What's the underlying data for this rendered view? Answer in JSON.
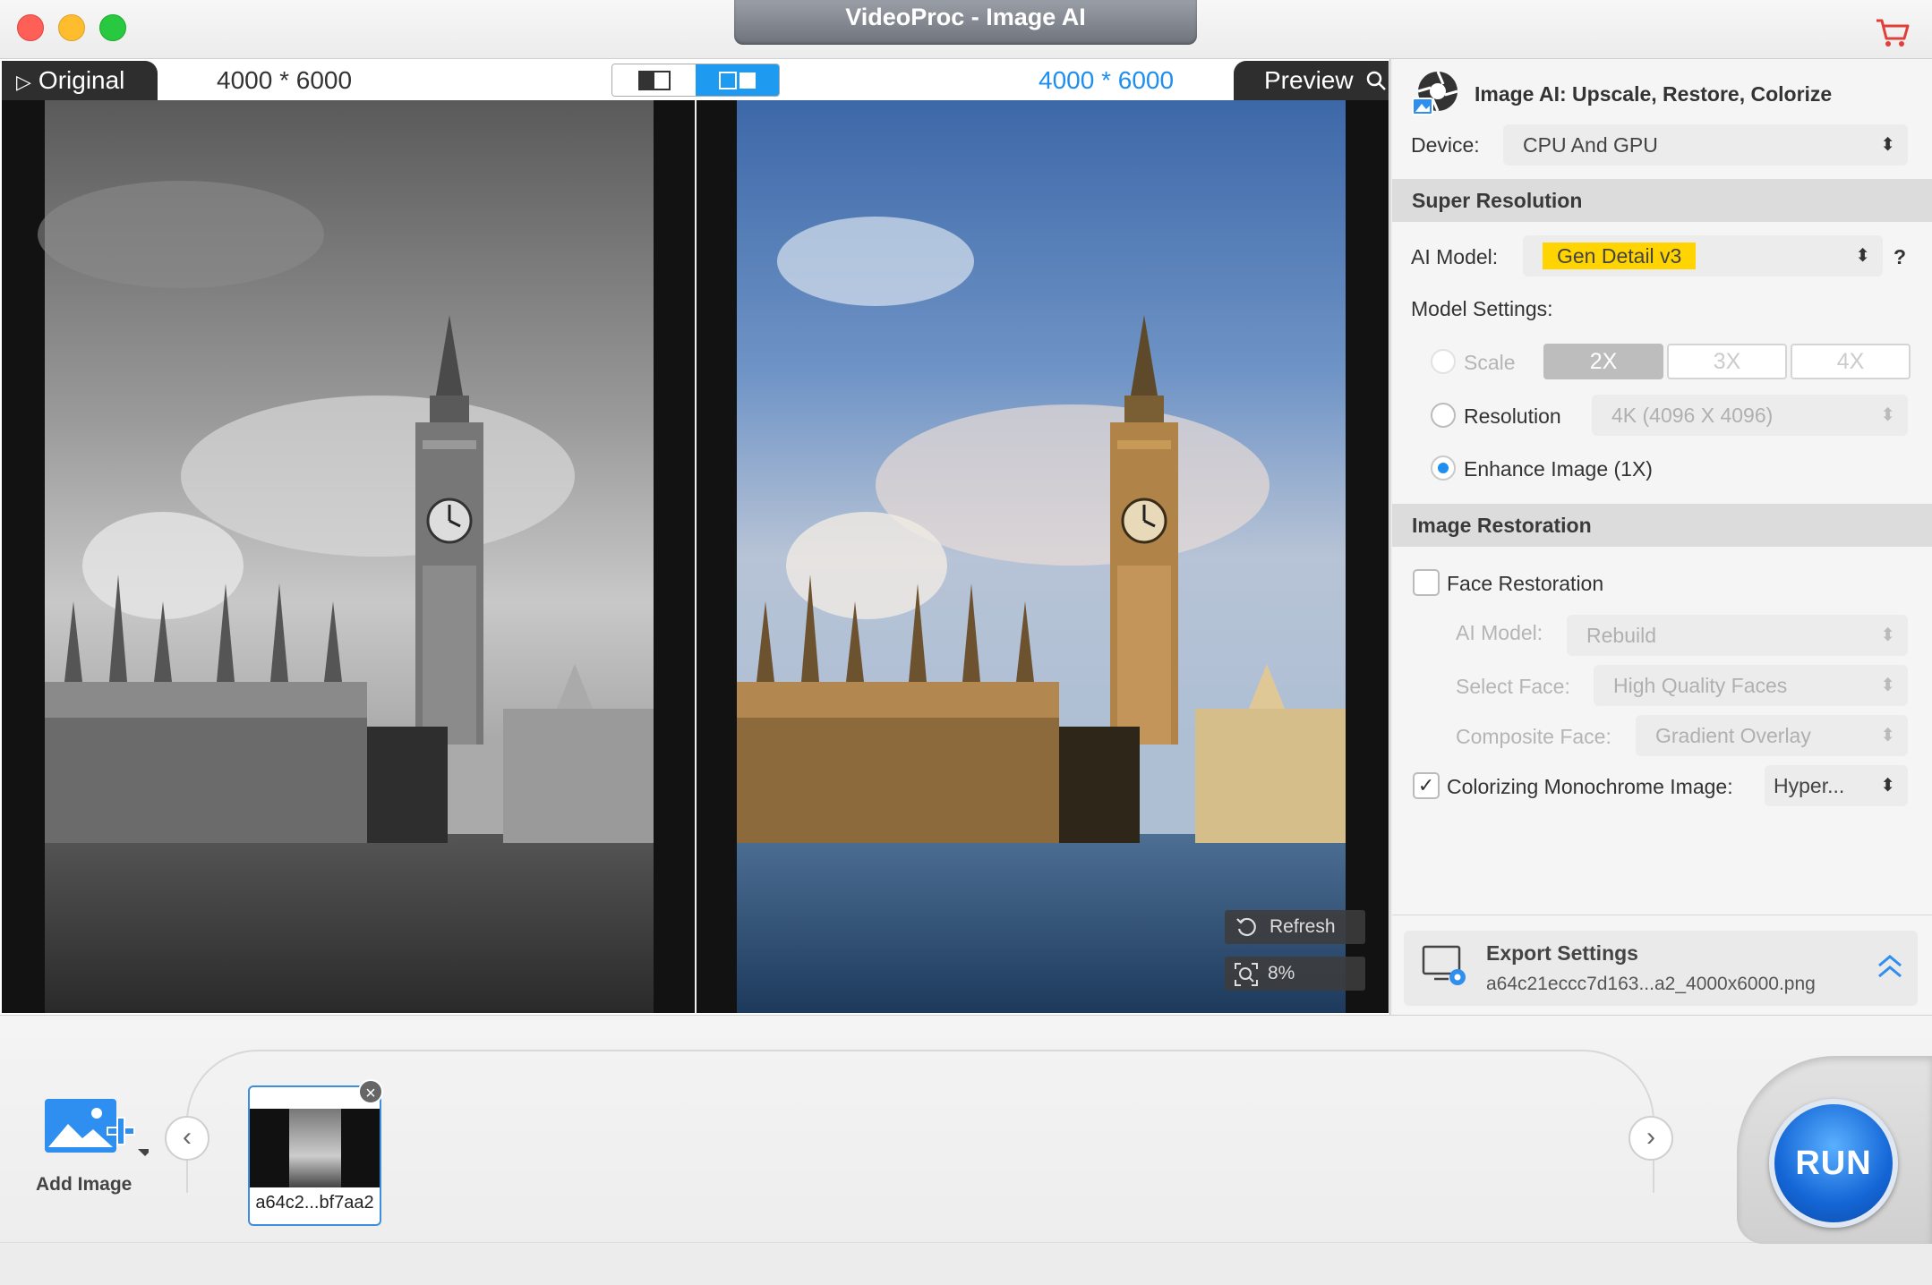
{
  "window": {
    "title": "VideoProc - Image AI"
  },
  "preview": {
    "original_label": "Original",
    "original_dims": "4000 * 6000",
    "preview_label": "Preview",
    "preview_dims": "4000 * 6000",
    "refresh_label": "Refresh",
    "zoom": "8%"
  },
  "panel": {
    "header": "Image AI: Upscale, Restore, Colorize",
    "device_label": "Device:",
    "device_value": "CPU And GPU",
    "super_resolution": {
      "title": "Super Resolution",
      "ai_model_label": "AI Model:",
      "ai_model_value": "Gen Detail v3",
      "help": "?",
      "model_settings_label": "Model Settings:",
      "scale_label": "Scale",
      "scale_options": [
        "2X",
        "3X",
        "4X"
      ],
      "resolution_label": "Resolution",
      "resolution_value": "4K (4096 X 4096)",
      "enhance_label": "Enhance Image (1X)"
    },
    "restoration": {
      "title": "Image Restoration",
      "face_label": "Face Restoration",
      "ai_model_label": "AI Model:",
      "ai_model_value": "Rebuild",
      "select_face_label": "Select Face:",
      "select_face_value": "High Quality Faces",
      "composite_label": "Composite Face:",
      "composite_value": "Gradient Overlay",
      "colorize_label": "Colorizing Monochrome Image:",
      "colorize_value": "Hyper..."
    },
    "export": {
      "title": "Export Settings",
      "filename": "a64c21eccc7d163...a2_4000x6000.png"
    }
  },
  "bottom": {
    "add_image_label": "Add Image",
    "thumb_name": "a64c2...bf7aa2",
    "run_label": "RUN"
  },
  "colors": {
    "accent": "#1e8ff0",
    "highlight": "#ffd400",
    "run": "#1466d6"
  }
}
